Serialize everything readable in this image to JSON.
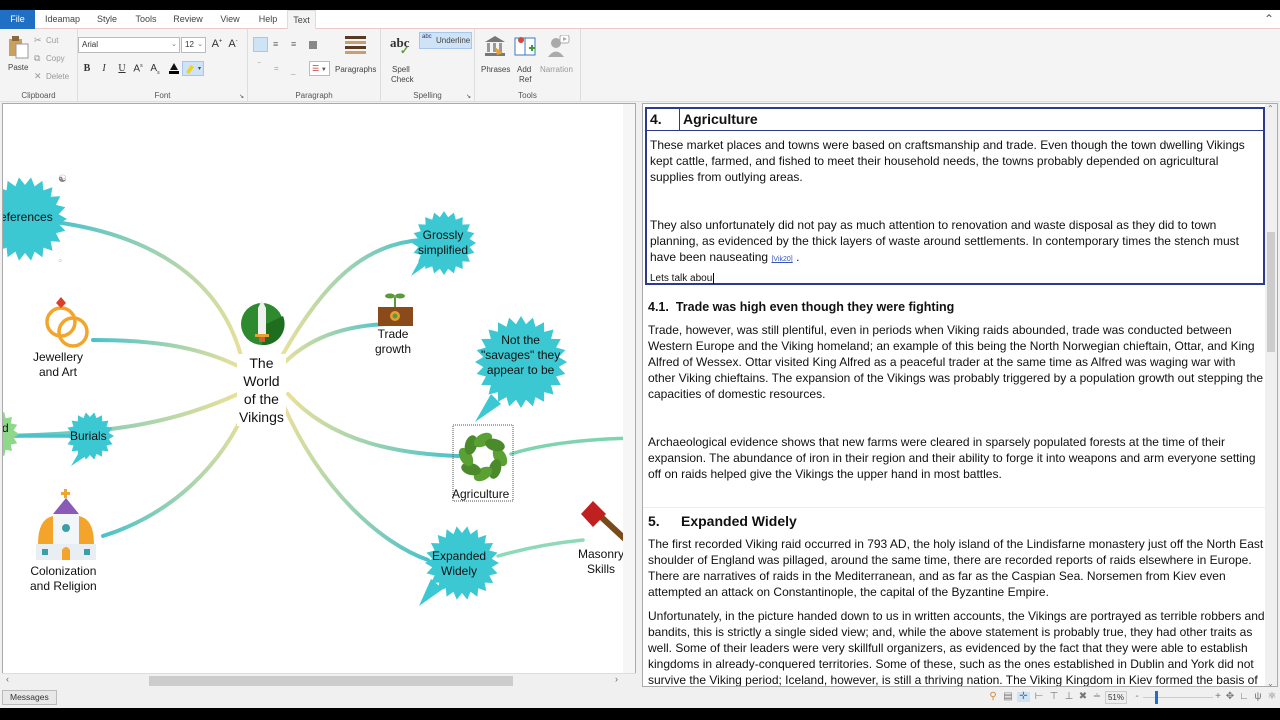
{
  "menu": {
    "tabs": [
      {
        "label": "File"
      },
      {
        "label": "Ideamap"
      },
      {
        "label": "Style"
      },
      {
        "label": "Tools"
      },
      {
        "label": "Review"
      },
      {
        "label": "View"
      },
      {
        "label": "Help"
      },
      {
        "label": "Text"
      }
    ],
    "active_tab": "Text",
    "collapse_icon": "chevron-up-icon"
  },
  "ribbon": {
    "clipboard": {
      "label": "Clipboard",
      "paste": "Paste",
      "cut": "Cut",
      "copy": "Copy",
      "delete": "Delete"
    },
    "font": {
      "label": "Font",
      "family": "Arial",
      "size": "12",
      "grow": "A",
      "shrink": "A",
      "bold": "B",
      "italic": "I",
      "underline": "U",
      "superscript": "A",
      "subscript": "A"
    },
    "paragraph": {
      "label": "Paragraph",
      "paragraphs": "Paragraphs"
    },
    "spelling": {
      "label": "Spelling",
      "spell_check_line1": "Spell",
      "spell_check_line2": "Check",
      "underline": "Underline",
      "underline_prefix": "abc"
    },
    "tools": {
      "label": "Tools",
      "phrases": "Phrases",
      "add_ref_line1": "Add",
      "add_ref_line2": "Ref",
      "narration": "Narration"
    }
  },
  "mindmap": {
    "central": {
      "lines": [
        "The",
        "World",
        "of the",
        "Vikings"
      ]
    },
    "nodes": [
      {
        "id": "references",
        "text": "eferences"
      },
      {
        "id": "jewellery",
        "lines": [
          "Jewellery",
          "and Art"
        ]
      },
      {
        "id": "burials",
        "text": "Burials"
      },
      {
        "id": "partial-left",
        "text": "d"
      },
      {
        "id": "colonization",
        "lines": [
          "Colonization",
          "and Religion"
        ]
      },
      {
        "id": "grossly",
        "lines": [
          "Grossly",
          "simplified"
        ]
      },
      {
        "id": "trade-growth",
        "lines": [
          "Trade",
          "growth"
        ]
      },
      {
        "id": "savages",
        "lines": [
          "Not the",
          "\"savages\" they",
          "appear to be"
        ]
      },
      {
        "id": "agriculture",
        "text": "Agriculture"
      },
      {
        "id": "expanded",
        "lines": [
          "Expanded",
          "Widely"
        ]
      },
      {
        "id": "masonry",
        "lines": [
          "Masonry",
          "Skills"
        ]
      }
    ],
    "colors": {
      "bubble": "#3cc8d2",
      "branch_teal": "#49c2cc",
      "branch_yellow": "#e8e09a",
      "sword_bg": "#2e8a2e"
    }
  },
  "document": {
    "sections": [
      {
        "number": "4.",
        "title": "Agriculture",
        "paragraphs": [
          "These market places and towns were based on craftsmanship and trade. Even though the town dwelling Vikings kept cattle, farmed, and fished to meet their household needs, the towns probably depended on agricultural supplies from outlying areas.",
          "They also unfortunately did not pay as much attention to renovation and waste disposal as they did to town planning, as evidenced by the thick layers of waste around settlements. In contemporary times the stench must have been nauseating"
        ],
        "ref": "[Vik20]",
        "ref_suffix": " .",
        "editing_text": "Lets talk abou"
      },
      {
        "number": "4.1.",
        "title": "Trade was high even though they were fighting",
        "paragraphs": [
          "Trade, however, was still plentiful, even in periods when Viking raids abounded, trade was conducted between Western Europe and the Viking homeland; an example of this being the North Norwegian chieftain, Ottar, and King Alfred of Wessex. Ottar visited King Alfred as a peaceful trader at the same time as Alfred was waging war with other Viking chieftains. The expansion of the Vikings was probably triggered by a population growth out stepping the capacities of domestic resources.",
          "Archaeological evidence shows that new farms were cleared in sparsely populated forests at the time of their expansion. The abundance of iron in their region and their ability to forge it into weapons and arm everyone setting off on raids helped give the Vikings the upper hand in most battles."
        ]
      },
      {
        "number": "5.",
        "title": "Expanded Widely",
        "paragraphs": [
          "The first recorded Viking raid occurred in 793 AD, the holy island of the Lindisfarne monastery just off the North East shoulder of England was pillaged, around the same time, there are recorded reports of raids elsewhere in Europe. There are narratives of raids in the Mediterranean, and as far as the Caspian Sea. Norsemen from Kiev even attempted an attack on Constantinople, the capital of the Byzantine Empire.",
          "Unfortunately, in the picture handed down to us in written accounts, the Vikings are portrayed as terrible robbers and bandits, this is strictly a single sided view; and, while the above statement is probably true, they had other traits as well. Some of their leaders were very skillfull organizers, as evidenced by the fact that they were able to establish kingdoms in already-conquered territories. Some of these, such as the ones established in Dublin and York did not survive the Viking period; Iceland, however, is still a thriving nation. The Viking Kingdom in Kiev formed the basis of the Russian Empire."
        ]
      }
    ]
  },
  "statusbar": {
    "messages": "Messages",
    "zoom": "51%",
    "zoom_minus": "-",
    "zoom_plus": "+",
    "zoom_level_percent": 51
  }
}
